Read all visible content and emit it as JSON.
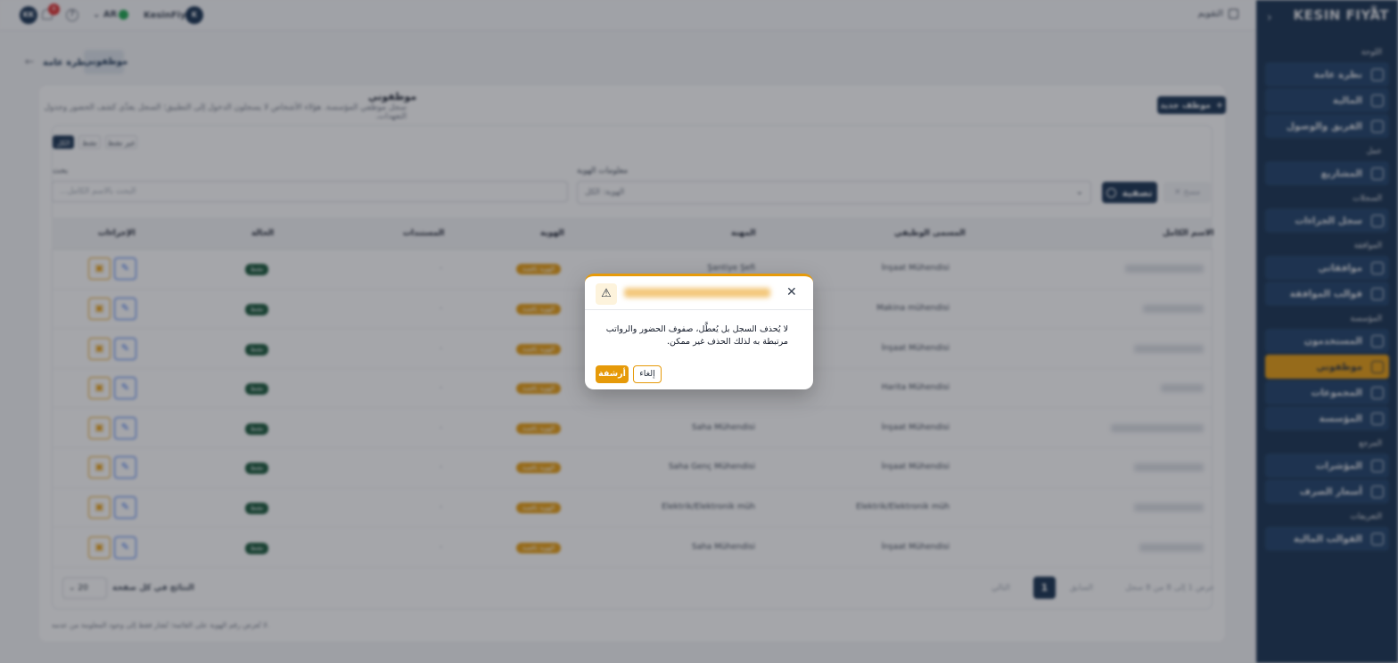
{
  "topbar": {
    "user_initials": "KK",
    "notifications_count": "8",
    "language": "AR",
    "company": "KesinFiyat",
    "company_initial": "K",
    "calendar_label": "التقويم"
  },
  "sidebar": {
    "brand": "KESIN FIYAT",
    "sections": [
      {
        "title": "اللوحة",
        "items": [
          "نظرة عامة",
          "المالية",
          "الفريق والوصول"
        ]
      },
      {
        "title": "عمل",
        "items": [
          "المشاريع"
        ]
      },
      {
        "title": "السجلات",
        "items": [
          "سجل الجزاءات"
        ]
      },
      {
        "title": "الموافقة",
        "items": [
          "موافقاتي",
          "قوالب الموافقة"
        ]
      },
      {
        "title": "المؤسسة",
        "items": [
          "المستخدمون",
          "موظفوني",
          "المجموعات",
          "المؤسسة"
        ]
      },
      {
        "title": "المرجع",
        "items": [
          "المؤشرات",
          "أسعار الصرف"
        ]
      },
      {
        "title": "التعريفات",
        "items": [
          "القوالب المالية"
        ]
      }
    ],
    "active_item": "موظفوني"
  },
  "breadcrumb": {
    "back_link": "نظرة عامة",
    "current": "موظفوني"
  },
  "page": {
    "title": "موظفوني",
    "subtitle": "سجل موظفي المؤسسة. هؤلاء الأشخاص لا يسجلون الدخول إلى التطبيق؛ السجل يغذّي كشف الحضور وجدول التعهدات.",
    "new_button": "موظف جديد"
  },
  "filters": {
    "chips": [
      "الكل",
      "نشط",
      "غير نشط"
    ],
    "search_label": "بحث",
    "search_placeholder": "...البحث بالاسم الكامل",
    "identity_label": "معلومات الهوية",
    "identity_value": "الهوية: الكل",
    "filter_button": "تصفية",
    "clear_button": "مسح"
  },
  "table": {
    "headers": [
      "الاسم الكامل",
      "المسمى الوظيفي",
      "المهنة",
      "الهوية",
      "المستندات",
      "الحالة",
      "الإجراءات"
    ],
    "rows": [
      {
        "title": "İnşaat Mühendisi",
        "profession": "Şantiye Şefi",
        "identity": "الهوية ناقصة",
        "docs": "-",
        "status": "نشط"
      },
      {
        "title": "Makina mühendisi",
        "profession": "",
        "identity": "الهوية ناقصة",
        "docs": "-",
        "status": "نشط"
      },
      {
        "title": "İnşaat Mühendisi",
        "profession": "",
        "identity": "الهوية ناقصة",
        "docs": "-",
        "status": "نشط"
      },
      {
        "title": "Harita Mühendisi",
        "profession": "",
        "identity": "الهوية ناقصة",
        "docs": "-",
        "status": "نشط"
      },
      {
        "title": "İnşaat Mühendisi",
        "profession": "Saha Mühendisi",
        "identity": "الهوية ناقصة",
        "docs": "-",
        "status": "نشط"
      },
      {
        "title": "İnşaat Mühendisi",
        "profession": "Saha Genç Mühendisi",
        "identity": "الهوية ناقصة",
        "docs": "-",
        "status": "نشط"
      },
      {
        "title": "Elektrik/Elektronik müh",
        "profession": "Elektrik/Elektronik müh",
        "identity": "الهوية ناقصة",
        "docs": "-",
        "status": "نشط"
      },
      {
        "title": "İnşaat Mühendisi",
        "profession": "Saha Mühendisi",
        "identity": "الهوية ناقصة",
        "docs": "-",
        "status": "نشط"
      }
    ]
  },
  "pagination": {
    "page_size": "20",
    "page_size_label": "النتائج في كل صفحة",
    "current_page": "1",
    "summary": "عرض 1 إلى 8 من 8 سجل",
    "prev": "السابق",
    "next": "التالي"
  },
  "footnote": "لا تُعرض رقم الهوية على القائمة؛ تُشار فقط إلى وجود المعلومة من عدمه.",
  "modal": {
    "body": "لا يُحذف السجل بل يُعطَّل، صفوف الحضور والرواتب مرتبطة به لذلك الحذف غير ممكن.",
    "archive_button": "أرشفة",
    "cancel_button": "إلغاء"
  },
  "colors": {
    "navy": "#0f2a4a",
    "accent": "#e69a09",
    "status_green": "#0f5132",
    "danger": "#dc2626"
  }
}
